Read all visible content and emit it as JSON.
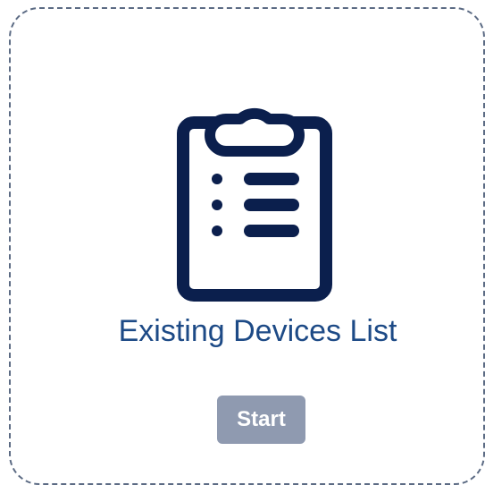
{
  "card": {
    "title": "Existing Devices List",
    "icon": "clipboard-list-icon",
    "start_label": "Start",
    "colors": {
      "border": "#5c6b84",
      "title": "#1d4a86",
      "icon": "#0b1f4d",
      "button_bg": "#8f9ab0",
      "button_text": "#ffffff"
    }
  }
}
